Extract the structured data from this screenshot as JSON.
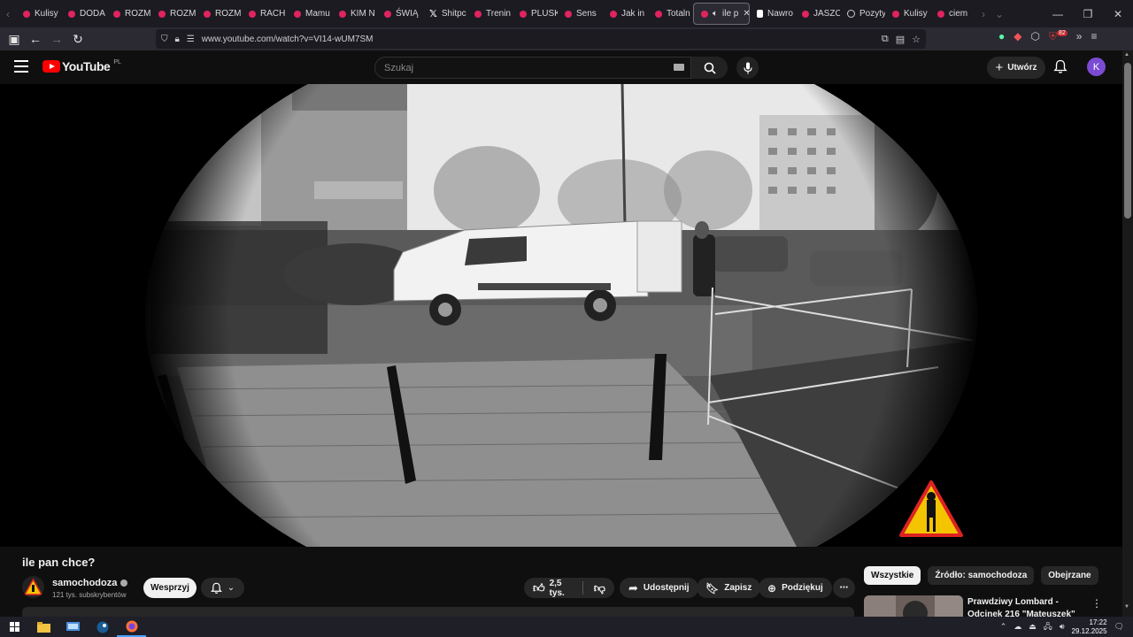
{
  "browser": {
    "tabs": [
      {
        "label": "Kulisy",
        "icon": "youtube-icon"
      },
      {
        "label": "DODA",
        "icon": "youtube-icon"
      },
      {
        "label": "ROZM",
        "icon": "youtube-icon"
      },
      {
        "label": "ROZM",
        "icon": "youtube-icon"
      },
      {
        "label": "ROZM",
        "icon": "youtube-icon"
      },
      {
        "label": "RACH",
        "icon": "youtube-icon"
      },
      {
        "label": "Mamu",
        "icon": "youtube-icon"
      },
      {
        "label": "KIM N",
        "icon": "youtube-icon"
      },
      {
        "label": "ŚWIĄ",
        "icon": "youtube-icon"
      },
      {
        "label": "Shitpc",
        "icon": "x-icon"
      },
      {
        "label": "Trenin",
        "icon": "youtube-icon"
      },
      {
        "label": "PLUSK",
        "icon": "youtube-icon"
      },
      {
        "label": "Sens ",
        "icon": "youtube-icon"
      },
      {
        "label": "Jak in",
        "icon": "youtube-icon"
      },
      {
        "label": "Totaln",
        "icon": "youtube-icon"
      },
      {
        "label": "ile p",
        "icon": "youtube-icon",
        "active": true
      },
      {
        "label": "Nawro",
        "icon": "tiktok-icon"
      },
      {
        "label": "JASZC",
        "icon": "youtube-icon"
      },
      {
        "label": "Pozyty",
        "icon": "play-icon"
      },
      {
        "label": "Kulisy",
        "icon": "youtube-icon"
      },
      {
        "label": "ciem",
        "icon": "youtube-icon"
      }
    ],
    "url": "www.youtube.com/watch?v=VI14-wUM7SM",
    "extension_badge": "82"
  },
  "youtube": {
    "logo_text": "YouTube",
    "country_code": "PL",
    "search_placeholder": "Szukaj",
    "create_label": "Utwórz",
    "avatar_letter": "K",
    "brand_color": "#ff0000"
  },
  "video": {
    "title": "ile pan chce?",
    "channel_name": "samochodoza",
    "subscribers": "121 tys. subskrybentów",
    "join_label": "Wesprzyj",
    "likes": "2,5 tys.",
    "share_label": "Udostępnij",
    "save_label": "Zapisz",
    "thanks_label": "Podziękuj"
  },
  "sidebar": {
    "chips": [
      "Wszystkie",
      "Źródło: samochodoza",
      "Obejrzane"
    ],
    "rec_title": "Prawdziwy Lombard - Odcinek 216 \"Mateuszek\""
  },
  "taskbar": {
    "time": "17:22",
    "date": "29.12.2025"
  }
}
